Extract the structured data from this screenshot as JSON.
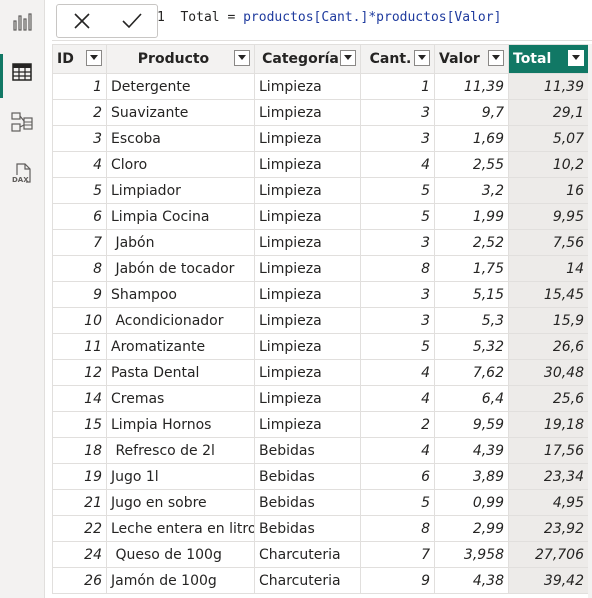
{
  "sidebar": {
    "items": [
      {
        "name": "report-view",
        "icon": "bar-chart-icon"
      },
      {
        "name": "data-view",
        "icon": "table-grid-icon",
        "active": true
      },
      {
        "name": "model-view",
        "icon": "model-diagram-icon"
      },
      {
        "name": "dax-query-view",
        "icon": "dax-file-icon",
        "label": "DAX"
      }
    ]
  },
  "formula_bar": {
    "line_number": "1",
    "formula_prefix": "Total = ",
    "formula_expr": "productos[Cant.]*productos[Valor]"
  },
  "table": {
    "columns": [
      "ID",
      "Producto",
      "Categoría",
      "Cant.",
      "Valor",
      "Total"
    ],
    "rows": [
      [
        "1",
        "Detergente",
        "Limpieza",
        "1",
        "11,39",
        "11,39"
      ],
      [
        "2",
        "Suavizante",
        "Limpieza",
        "3",
        "9,7",
        "29,1"
      ],
      [
        "3",
        "Escoba",
        "Limpieza",
        "3",
        "1,69",
        "5,07"
      ],
      [
        "4",
        "Cloro",
        "Limpieza",
        "4",
        "2,55",
        "10,2"
      ],
      [
        "5",
        "Limpiador",
        "Limpieza",
        "5",
        "3,2",
        "16"
      ],
      [
        "6",
        "Limpia Cocina",
        "Limpieza",
        "5",
        "1,99",
        "9,95"
      ],
      [
        "7",
        " Jabón",
        "Limpieza",
        "3",
        "2,52",
        "7,56"
      ],
      [
        "8",
        " Jabón de tocador",
        "Limpieza",
        "8",
        "1,75",
        "14"
      ],
      [
        "9",
        "Shampoo",
        "Limpieza",
        "3",
        "5,15",
        "15,45"
      ],
      [
        "10",
        " Acondicionador",
        "Limpieza",
        "3",
        "5,3",
        "15,9"
      ],
      [
        "11",
        "Aromatizante",
        "Limpieza",
        "5",
        "5,32",
        "26,6"
      ],
      [
        "12",
        "Pasta Dental",
        "Limpieza",
        "4",
        "7,62",
        "30,48"
      ],
      [
        "14",
        "Cremas",
        "Limpieza",
        "4",
        "6,4",
        "25,6"
      ],
      [
        "15",
        "Limpia Hornos",
        "Limpieza",
        "2",
        "9,59",
        "19,18"
      ],
      [
        "18",
        " Refresco de 2l",
        "Bebidas",
        "4",
        "4,39",
        "17,56"
      ],
      [
        "19",
        "Jugo 1l",
        "Bebidas",
        "6",
        "3,89",
        "23,34"
      ],
      [
        "21",
        "Jugo en sobre",
        "Bebidas",
        "5",
        "0,99",
        "4,95"
      ],
      [
        "22",
        "Leche entera en litro",
        "Bebidas",
        "8",
        "2,99",
        "23,92"
      ],
      [
        "24",
        " Queso de 100g",
        "Charcuteria",
        "7",
        "3,958",
        "27,706"
      ],
      [
        "26",
        "Jamón de 100g",
        "Charcuteria",
        "9",
        "4,38",
        "39,42"
      ]
    ]
  },
  "colors": {
    "accent": "#117865",
    "formula_code": "#1f3b9e"
  }
}
